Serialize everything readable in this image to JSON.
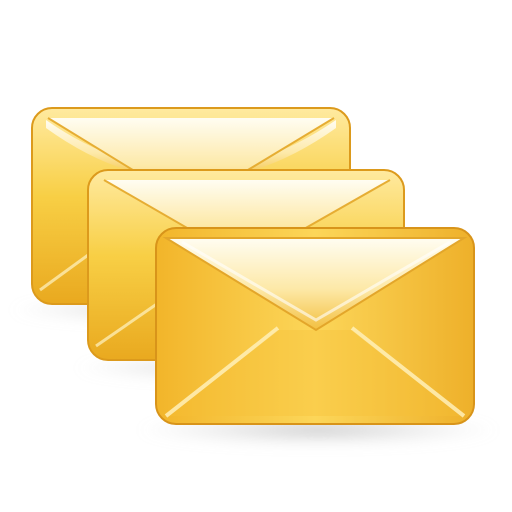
{
  "icon": {
    "name": "multiple-envelopes-icon",
    "colors": {
      "body_light": "#ffe58a",
      "body_mid": "#f7c531",
      "body_dark": "#e3a11a",
      "edge": "#d8941a",
      "flap_highlight": "#fffbe6",
      "shadow": "#c9c9c9"
    }
  }
}
